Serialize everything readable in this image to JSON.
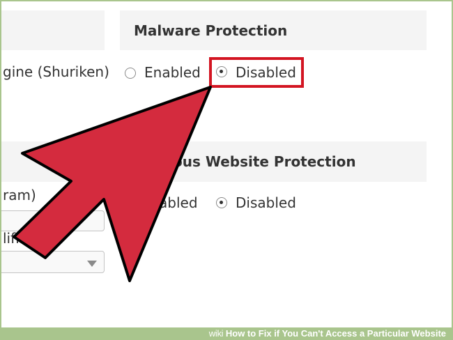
{
  "sections": {
    "malware": {
      "title": "Malware Protection",
      "engine_label": "gine (Shuriken)",
      "options": [
        {
          "label": "Enabled",
          "selected": false
        },
        {
          "label": "Disabled",
          "selected": true
        }
      ]
    },
    "website": {
      "title": "ous Website Protection",
      "left_label_1": "ram)",
      "left_label_2": "lific",
      "options": [
        {
          "label": "abled",
          "selected": false
        },
        {
          "label": "Disabled",
          "selected": true
        }
      ]
    }
  },
  "colors": {
    "arrow_fill": "#d42b3e",
    "arrow_stroke": "#000000",
    "highlight_border": "#d31522",
    "footer_bg": "#a9c58d"
  },
  "footer": {
    "wiki": "wiki",
    "how": "How to Fix if You Can't Access a Particular Website"
  }
}
